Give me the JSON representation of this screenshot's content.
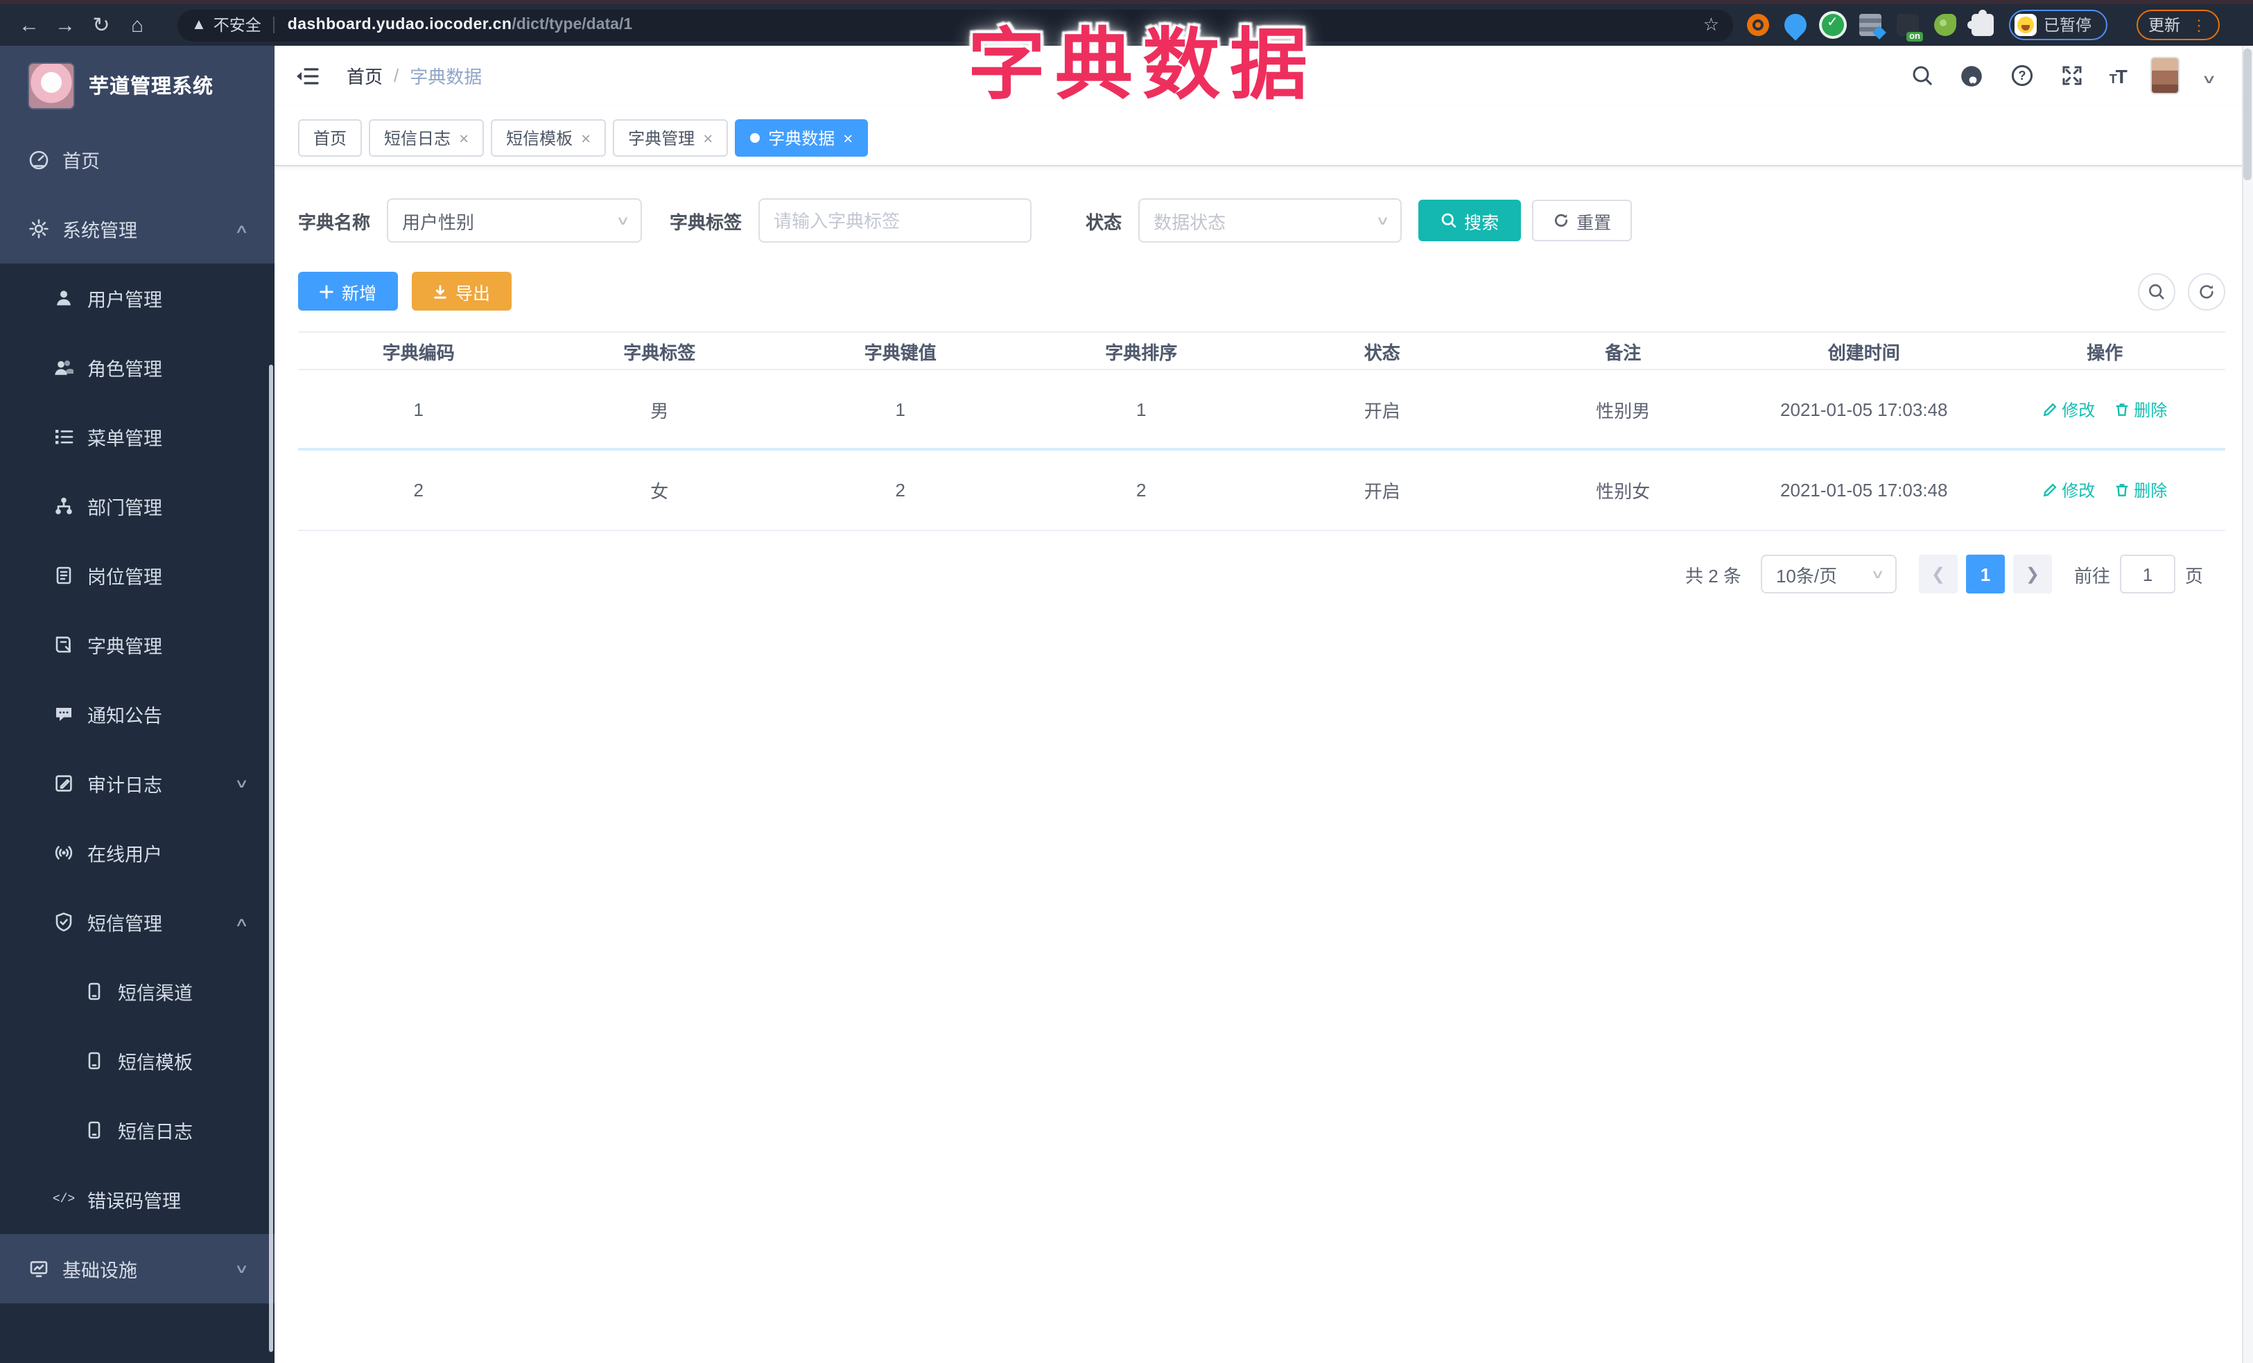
{
  "browser": {
    "security_warning": "不安全",
    "url_host": "dashboard.yudao.iocoder.cn",
    "url_path": "/dict/type/data/1",
    "on_badge": "on",
    "paused_badge": "已暂停",
    "update_button": "更新"
  },
  "overlay": {
    "title": "字典数据"
  },
  "sidebar": {
    "app_title": "芋道管理系统",
    "items": [
      {
        "label": "首页",
        "level": 1,
        "icon": "dashboard-icon"
      },
      {
        "label": "系统管理",
        "level": 1,
        "icon": "gear-icon",
        "caret": "up"
      },
      {
        "label": "用户管理",
        "level": 2,
        "icon": "user-icon"
      },
      {
        "label": "角色管理",
        "level": 2,
        "icon": "users-icon"
      },
      {
        "label": "菜单管理",
        "level": 2,
        "icon": "menu-list-icon"
      },
      {
        "label": "部门管理",
        "level": 2,
        "icon": "org-tree-icon"
      },
      {
        "label": "岗位管理",
        "level": 2,
        "icon": "badge-icon"
      },
      {
        "label": "字典管理",
        "level": 2,
        "icon": "book-icon"
      },
      {
        "label": "通知公告",
        "level": 2,
        "icon": "notice-bubble-icon"
      },
      {
        "label": "审计日志",
        "level": 2,
        "icon": "edit-square-icon",
        "caret": "down"
      },
      {
        "label": "在线用户",
        "level": 2,
        "icon": "online-signal-icon"
      },
      {
        "label": "短信管理",
        "level": 2,
        "icon": "shield-check-icon",
        "caret": "up"
      },
      {
        "label": "短信渠道",
        "level": 3,
        "icon": "phone-icon"
      },
      {
        "label": "短信模板",
        "level": 3,
        "icon": "phone-icon"
      },
      {
        "label": "短信日志",
        "level": 3,
        "icon": "phone-icon"
      },
      {
        "label": "错误码管理",
        "level": 2,
        "icon": "code-icon"
      },
      {
        "label": "基础设施",
        "level": 1,
        "icon": "monitor-icon",
        "caret": "down"
      }
    ]
  },
  "header": {
    "breadcrumb_home": "首页",
    "breadcrumb_separator": "/",
    "breadcrumb_current": "字典数据",
    "icons": [
      "search-icon",
      "github-icon",
      "help-icon",
      "fullscreen-icon",
      "font-size-icon",
      "avatar",
      "chevron-down-icon"
    ]
  },
  "tabs": [
    {
      "label": "首页",
      "closable": false,
      "active": false
    },
    {
      "label": "短信日志",
      "closable": true,
      "active": false
    },
    {
      "label": "短信模板",
      "closable": true,
      "active": false
    },
    {
      "label": "字典管理",
      "closable": true,
      "active": false
    },
    {
      "label": "字典数据",
      "closable": true,
      "active": true
    }
  ],
  "tab_close_glyph": "×",
  "filters": {
    "dict_name_label": "字典名称",
    "dict_name_value": "用户性别",
    "dict_label_label": "字典标签",
    "dict_label_placeholder": "请输入字典标签",
    "status_label": "状态",
    "status_placeholder": "数据状态",
    "search_button": "搜索",
    "reset_button": "重置"
  },
  "toolbar": {
    "add_button": "新增",
    "export_button": "导出"
  },
  "table": {
    "columns": [
      "字典编码",
      "字典标签",
      "字典键值",
      "字典排序",
      "状态",
      "备注",
      "创建时间",
      "操作"
    ],
    "rows": [
      {
        "code": "1",
        "label": "男",
        "value": "1",
        "sort": "1",
        "status": "开启",
        "remark": "性别男",
        "created": "2021-01-05 17:03:48"
      },
      {
        "code": "2",
        "label": "女",
        "value": "2",
        "sort": "2",
        "status": "开启",
        "remark": "性别女",
        "created": "2021-01-05 17:03:48"
      }
    ],
    "edit_label": "修改",
    "delete_label": "删除"
  },
  "pagination": {
    "total_text": "共 2 条",
    "page_size": "10条/页",
    "current_page": "1",
    "goto_label": "前往",
    "goto_value": "1",
    "page_unit": "页"
  },
  "colors": {
    "accent_blue": "#409eff",
    "teal": "#14b8b0",
    "warning_orange": "#f0a73c",
    "overlay_pink": "#ee2f5e",
    "sidebar_dark": "#202c3d",
    "sidebar_light": "#384661"
  }
}
